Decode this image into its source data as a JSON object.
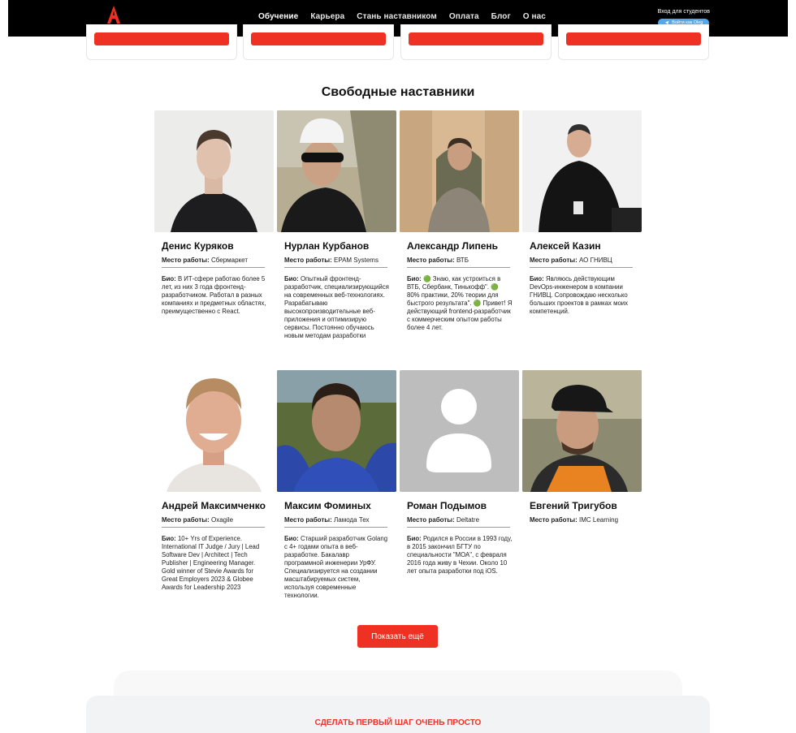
{
  "header": {
    "nav": [
      "Обучение",
      "Карьера",
      "Стань наставником",
      "Оплата",
      "Блог",
      "О нас"
    ],
    "active_index": 0,
    "login_label": "Вход для студентов",
    "telegram_button": "Войти как Oleg",
    "brand_color": "#ef3124"
  },
  "section_title": "Свободные наставники",
  "work_label": "Место работы:",
  "bio_label": "Био:",
  "mentors": [
    {
      "name": "Денис Куряков",
      "work": "Сбермаркет",
      "bio": "В ИТ-сфере работаю более 5 лет, из них 3 года фронтенд-разработчиком. Работал в разных компаниях и предметных областях, преимущественно с React."
    },
    {
      "name": "Нурлан Курбанов",
      "work": "EPAM Systems",
      "bio": "Опытный фронтенд-разработчик, специализирующийся на современных веб-технологиях. Разрабатываю высокопроизводительные веб-приложения и оптимизирую сервисы. Постоянно обучаюсь новым методам разработки"
    },
    {
      "name": "Александр Липень",
      "work": "ВТБ",
      "bio": "🟢 Знаю, как устроиться в ВТБ, Сбербанк, Тинькофф\". 🟢 80% практики, 20% теории для быстрого результата\". 🟢 Привет! Я действующий frontend-разработчик с коммерческим опытом работы более 4 лет."
    },
    {
      "name": "Алексей Казин",
      "work": "АО ГНИВЦ",
      "bio": "Являюсь действующим DevOps-инженером в компании ГНИВЦ. Сопровождаю несколько больших проектов в рамках моих компетенций."
    },
    {
      "name": "Андрей Максимченко",
      "work": "Oxagile",
      "bio": "10+ Yrs of Experience. International IT Judge / Jury | Lead Software Dev | Architect | Tech Publisher | Engineering Manager. Gold winner of Stevie Awards for Great Employers 2023 & Globee Awards for Leadership 2023"
    },
    {
      "name": "Максим Фоминых",
      "work": "Ламода Тех",
      "bio": "Старший разработчик Golang с 4+ годами опыта в веб-разработке. Бакалавр программной инженерии УрФУ. Специализируется на создании масштабируемых систем, используя современные технологии."
    },
    {
      "name": "Роман Подымов",
      "work": "Deltatre",
      "bio": "Родился в России в 1993 году, в 2015 закончил БГТУ по специальности \"МОА\", с февраля 2016 года живу в Чехии. Около 10 лет опыта разработки под iOS."
    },
    {
      "name": "Евгений Тригубов",
      "work": "IMC Learning",
      "bio": ""
    }
  ],
  "show_more": "Показать ещё",
  "bottom_heading": "СДЕЛАТЬ ПЕРВЫЙ ШАГ ОЧЕНЬ ПРОСТО"
}
